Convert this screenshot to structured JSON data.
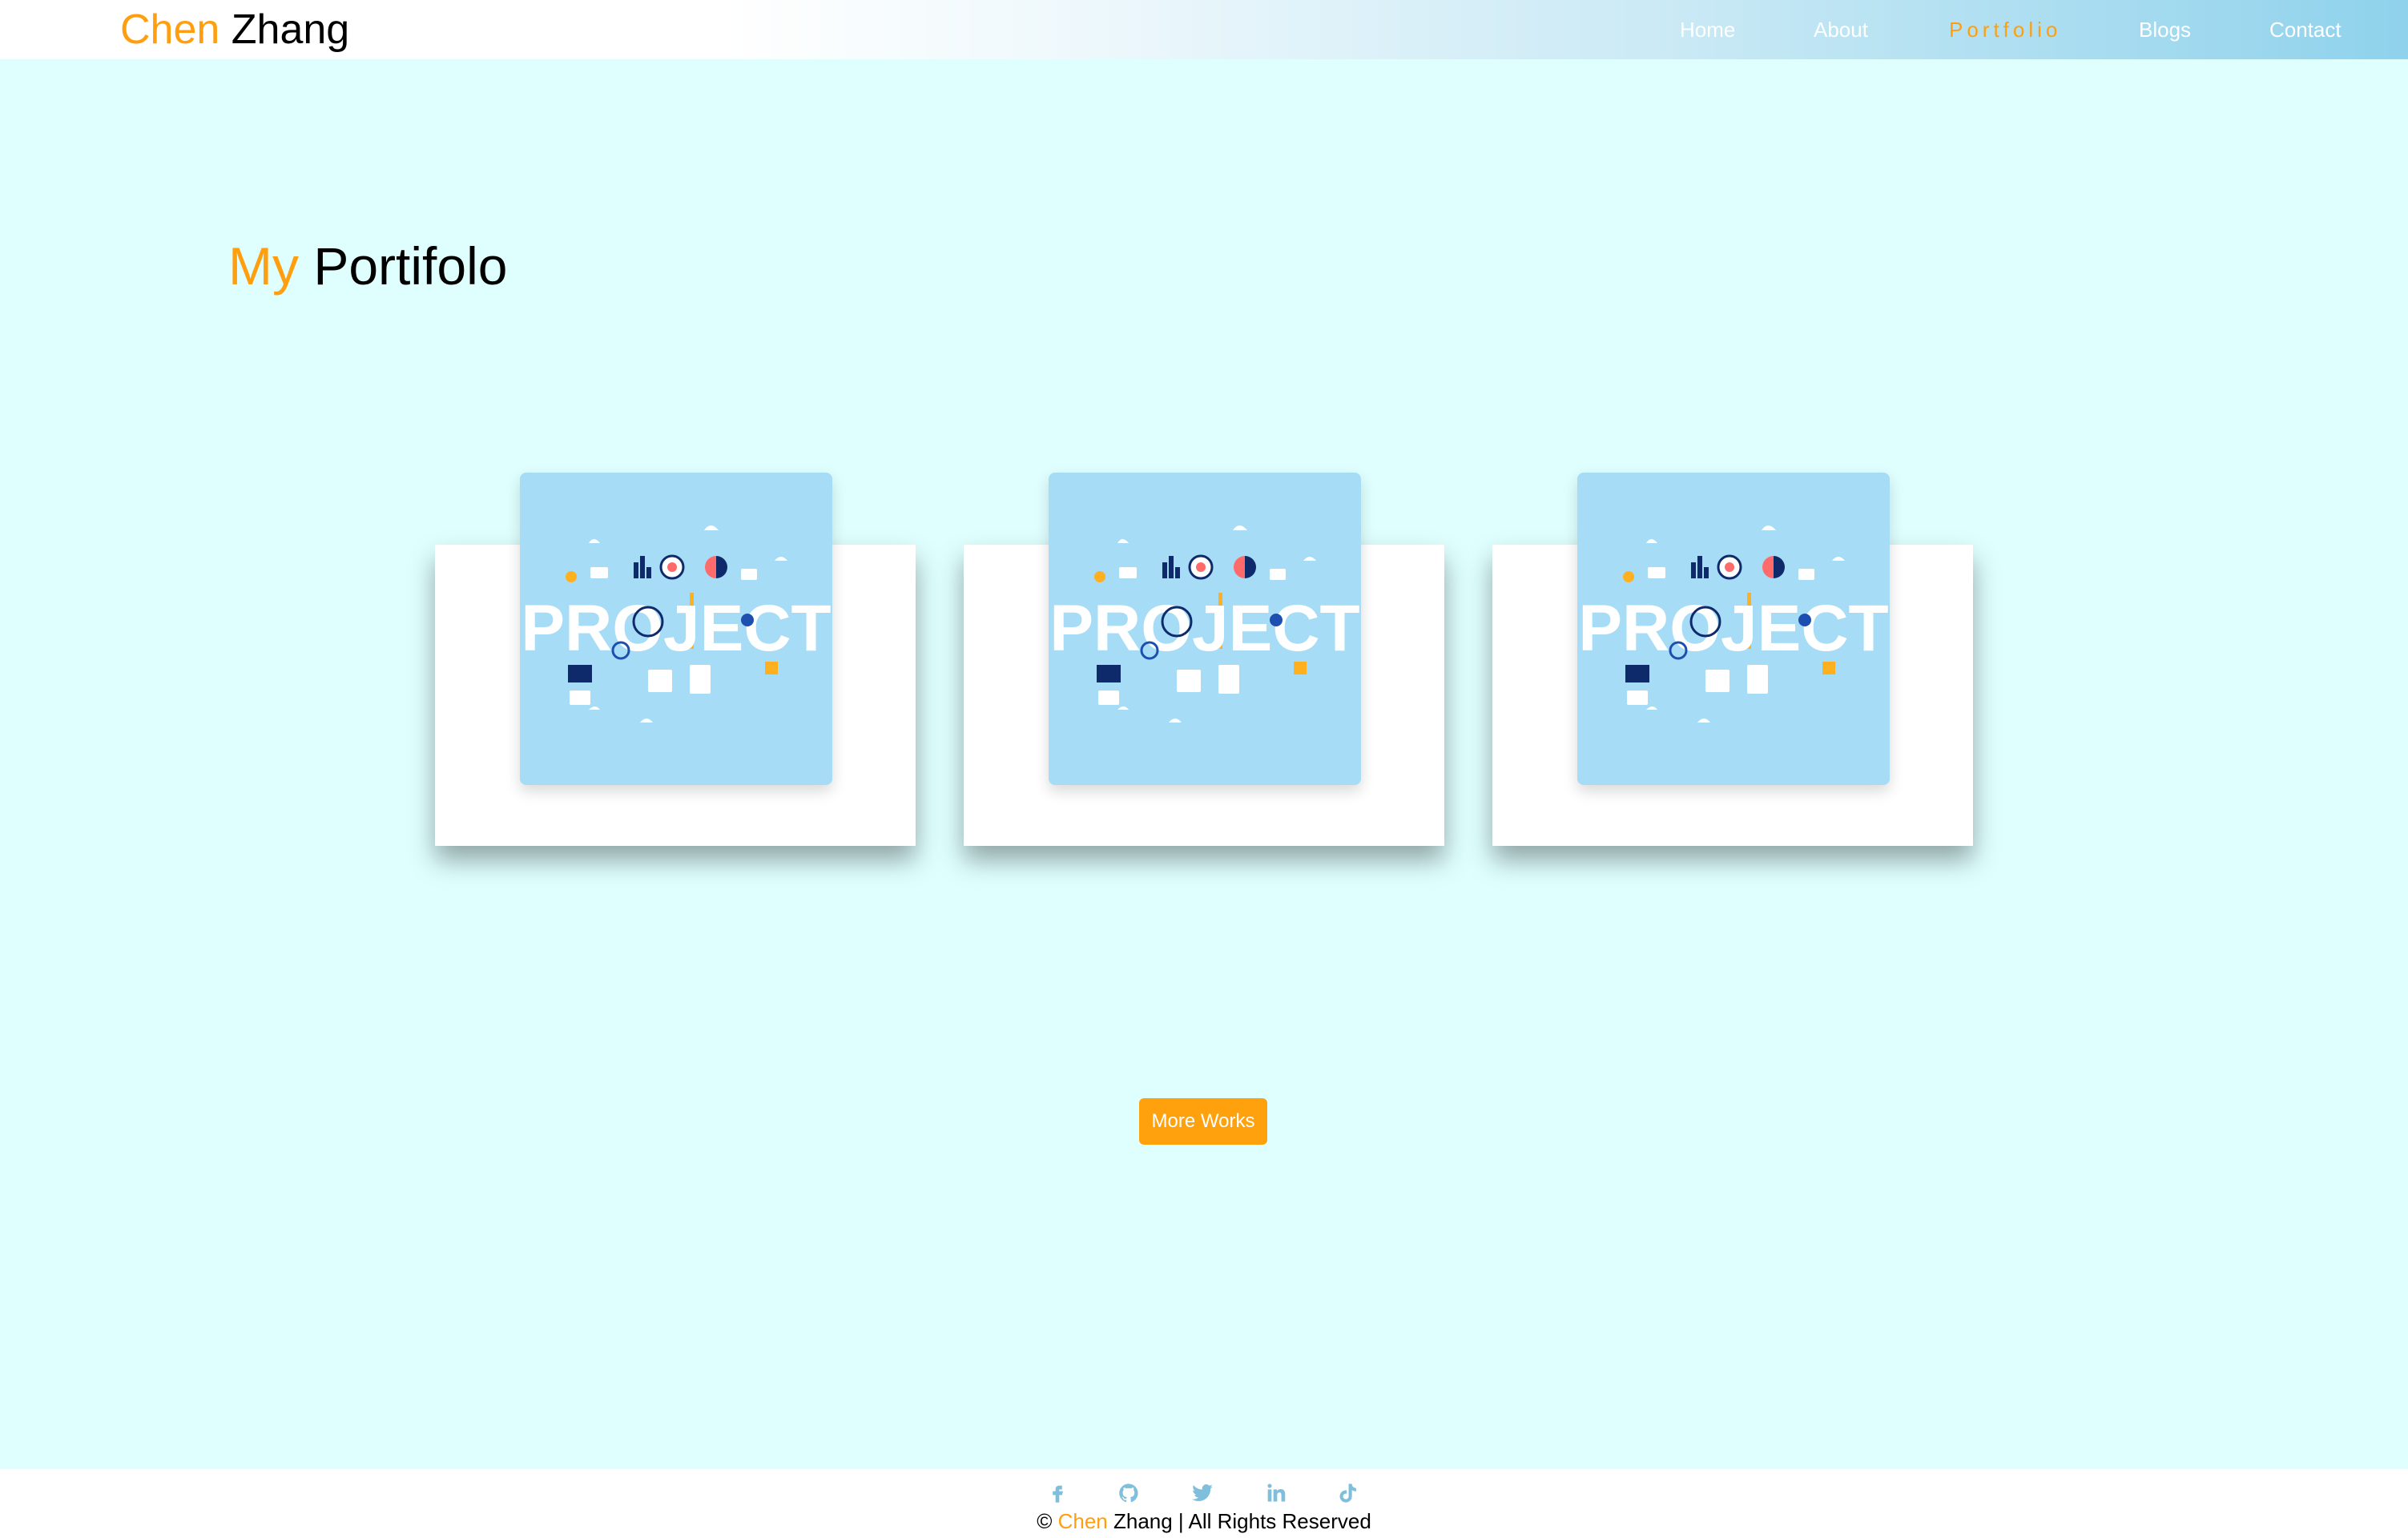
{
  "header": {
    "logo_first": "Chen",
    "logo_last": "Zhang",
    "nav": [
      {
        "label": "Home"
      },
      {
        "label": "About"
      },
      {
        "label": "Portfolio",
        "active": true
      },
      {
        "label": "Blogs"
      },
      {
        "label": "Contact"
      }
    ]
  },
  "main": {
    "title_accent": "My",
    "title_rest": "Portifolo",
    "cards": [
      {
        "image_text": "PROJECT"
      },
      {
        "image_text": "PROJECT"
      },
      {
        "image_text": "PROJECT"
      }
    ],
    "more_button": "More Works"
  },
  "footer": {
    "social": [
      "facebook-icon",
      "github-icon",
      "twitter-icon",
      "linkedin-icon",
      "tiktok-icon"
    ],
    "copyright_prefix": "©",
    "copyright_accent": "Chen",
    "copyright_rest": "Zhang | All Rights Reserved"
  },
  "colors": {
    "accent": "#ff9f0f",
    "background": "#dfffff",
    "card_image": "#a6dcf5",
    "social_icon": "#7fbfdc"
  }
}
